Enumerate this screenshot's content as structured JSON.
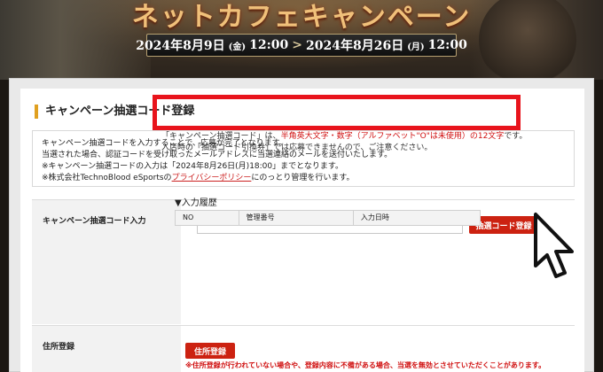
{
  "hero": {
    "title": "ネットカフェキャンペーン",
    "start": "2024年8月9日",
    "start_day": "(金)",
    "start_time": "12:00",
    "arrow": ">",
    "end": "2024年8月26日",
    "end_day": "(月)",
    "end_time": "12:00"
  },
  "section": {
    "title": "キャンペーン抽選コード登録"
  },
  "notice": {
    "line1": "キャンペーン抽選コードを入力することで、応募が完了となります。",
    "line2": "当選された場合、認証コードを受け取ったメールアドレスに当選連絡のメールを送付いたします。",
    "line3": "※キャンペーン抽選コードの入力は「2024年8月26日(月)18:00」までとなります。",
    "line4_prefix": "※株式会社TechnoBlood eSportsの",
    "line4_link": "プライバシーポリシー",
    "line4_suffix": "にのっとり管理を行います。"
  },
  "form": {
    "code_label": "キャンペーン抽選コード入力",
    "code_value": "",
    "register_label": "抽選コード登録",
    "help_line1_a": "「キャンペーン抽選コード」は、",
    "help_line1_b": "半角英大文字・数字（アルファベット\"O\"は未使用）の12文字",
    "help_line1_c": "です。",
    "help_line2": "入店時の「抽選コード引換券」では応募できませんので、ご注意ください。",
    "history_heading": "▼入力履歴",
    "history_cols": [
      "NO",
      "管理番号",
      "入力日時"
    ],
    "address_label": "住所登録",
    "address_button": "住所登録",
    "address_warning": "※住所登録が行われていない場合や、登録内容に不備がある場合、当選を無効とさせていただくことがあります。"
  },
  "colors": {
    "accent_red": "#cc2211",
    "highlight": "#e8141c",
    "title_bar": "#e0a020"
  }
}
